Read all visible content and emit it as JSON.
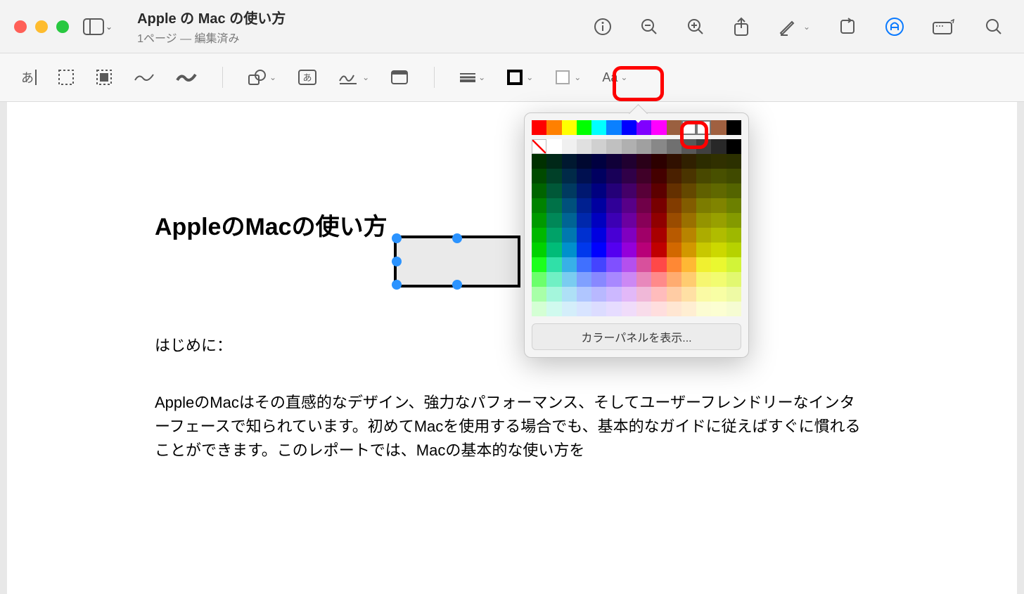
{
  "window": {
    "title": "Apple の Mac の使い方",
    "subtitle": "1ページ — 編集済み"
  },
  "document": {
    "heading": "AppleのMacの使い方",
    "intro_label": "はじめに：",
    "body_p1": "AppleのMacはその直感的なデザイン、強力なパフォーマンス、そしてユーザーフレンドリーなインターフェースで知られています。初めてMacを使用する場合でも、基本的なガイドに従えばすぐに慣れることができます。このレポートでは、Macの基本的な使い方を"
  },
  "formatbar": {
    "font_label": "Aa"
  },
  "colorPopover": {
    "show_panel_label": "カラーパネルを表示...",
    "top_row": [
      "#ff0000",
      "#ff8000",
      "#ffff00",
      "#00ff00",
      "#00ffff",
      "#0a80ff",
      "#0000ff",
      "#8000ff",
      "#ff00ff",
      "#9a6040",
      "#ffffff",
      "#ffffff",
      "#a06040",
      "#000000"
    ],
    "gray_row": [
      "#ffffff",
      "#ffffff",
      "#f0f0f0",
      "#e0e0e0",
      "#d0d0d0",
      "#c0c0c0",
      "#b0b0b0",
      "#a0a0a0",
      "#888888",
      "#707070",
      "#585858",
      "#404040",
      "#282828",
      "#000000"
    ],
    "grid_rows": [
      [
        "#003000",
        "#002818",
        "#001830",
        "#000830",
        "#000040",
        "#100038",
        "#200030",
        "#2a0018",
        "#2c0000",
        "#301000",
        "#302000",
        "#2c2c00",
        "#303000",
        "#2c3000"
      ],
      [
        "#004a00",
        "#004028",
        "#002a48",
        "#001050",
        "#000060",
        "#180058",
        "#300048",
        "#400028",
        "#440000",
        "#4a2000",
        "#4a3400",
        "#484800",
        "#485000",
        "#404a00"
      ],
      [
        "#006400",
        "#005838",
        "#003a60",
        "#001870",
        "#000080",
        "#240078",
        "#440068",
        "#580038",
        "#5c0000",
        "#643000",
        "#644800",
        "#606000",
        "#606800",
        "#546400"
      ],
      [
        "#008200",
        "#007248",
        "#00507c",
        "#002090",
        "#0000a0",
        "#300098",
        "#580088",
        "#700048",
        "#780000",
        "#823c00",
        "#825c00",
        "#7c7c00",
        "#808400",
        "#6c8000"
      ],
      [
        "#009a00",
        "#008858",
        "#006494",
        "#0028ac",
        "#0000c0",
        "#3c00b4",
        "#6c00a0",
        "#880058",
        "#900000",
        "#9a4c00",
        "#9a7000",
        "#949400",
        "#98a000",
        "#849a00"
      ],
      [
        "#00b800",
        "#00a268",
        "#0078b0",
        "#0030d0",
        "#0000e0",
        "#4800d4",
        "#8000c0",
        "#a00068",
        "#a80000",
        "#b85a00",
        "#b88400",
        "#acac00",
        "#b0bc00",
        "#9eb800"
      ],
      [
        "#00d200",
        "#00bc78",
        "#0090cc",
        "#0038ec",
        "#0000ff",
        "#5400f0",
        "#9400da",
        "#b80078",
        "#c00000",
        "#d26800",
        "#d29800",
        "#c8c800",
        "#ccd800",
        "#b6d200"
      ],
      [
        "#1cff1c",
        "#30e0a8",
        "#38b0e8",
        "#4070ff",
        "#4444ff",
        "#8050ff",
        "#b450ee",
        "#d8509c",
        "#ff4848",
        "#ff8834",
        "#ffb834",
        "#f0f030",
        "#eaf830",
        "#d2f438"
      ],
      [
        "#6cff6c",
        "#70f0c4",
        "#7accf0",
        "#80a0ff",
        "#8888ff",
        "#a888ff",
        "#cc88f4",
        "#e888bc",
        "#ff8a8a",
        "#ffac70",
        "#ffcc70",
        "#f6f670",
        "#f2fc70",
        "#e2f870"
      ],
      [
        "#a8ffa8",
        "#a4f6dc",
        "#aee0f6",
        "#b0c6ff",
        "#b8b8ff",
        "#ccb8ff",
        "#e2b8f8",
        "#f0b8d8",
        "#ffbcbc",
        "#ffcca4",
        "#ffe0a4",
        "#fafaa4",
        "#f8fea4",
        "#eefaa4"
      ],
      [
        "#d4ffd4",
        "#d0faee",
        "#d4eefa",
        "#d8e4ff",
        "#dcdcff",
        "#e6dcff",
        "#f0dcfa",
        "#f8dcea",
        "#ffdede",
        "#ffe6d2",
        "#ffeed2",
        "#fcfcd2",
        "#fcfed2",
        "#f6fcd2"
      ]
    ]
  }
}
